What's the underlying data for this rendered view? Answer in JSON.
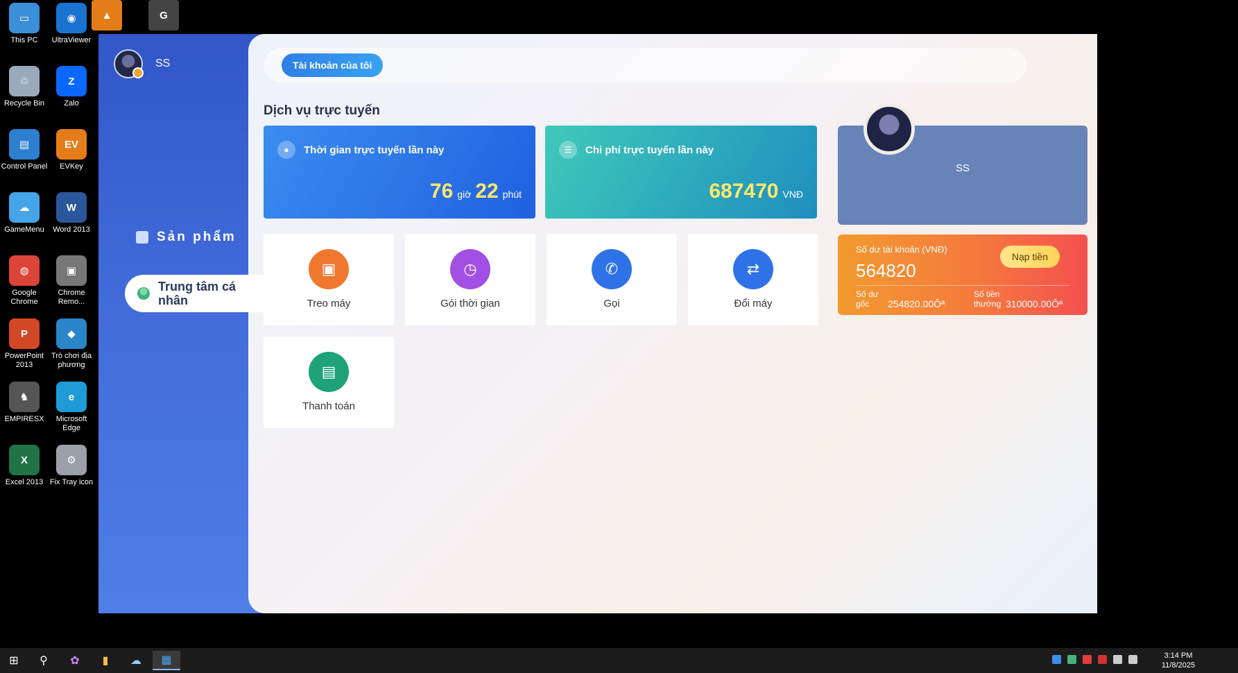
{
  "desktop": {
    "icons": [
      {
        "label": "This PC",
        "name": "this-pc-icon",
        "color": "#3b8fd8"
      },
      {
        "label": "UltraViewer",
        "name": "ultraviewer-icon",
        "color": "#1a73d1"
      },
      {
        "label": "Recycle Bin",
        "name": "recycle-bin-icon",
        "color": "#9ab"
      },
      {
        "label": "Zalo",
        "name": "zalo-icon",
        "color": "#0a68ff"
      },
      {
        "label": "Control Panel",
        "name": "control-panel-icon",
        "color": "#2d7fd0"
      },
      {
        "label": "EVKey",
        "name": "evkey-icon",
        "color": "#e57c1a"
      },
      {
        "label": "GameMenu",
        "name": "gamemenu-icon",
        "color": "#46a5e8"
      },
      {
        "label": "Word 2013",
        "name": "word-icon",
        "color": "#2b579a"
      },
      {
        "label": "Google Chrome",
        "name": "chrome-icon",
        "color": "#db4437"
      },
      {
        "label": "Chrome Remo...",
        "name": "chrome-remote-icon",
        "color": "#777"
      },
      {
        "label": "PowerPoint 2013",
        "name": "powerpoint-icon",
        "color": "#d24726"
      },
      {
        "label": "Trò chơi địa phương",
        "name": "local-games-icon",
        "color": "#2a85c9"
      },
      {
        "label": "EMPIRESX",
        "name": "empiresx-icon",
        "color": "#555"
      },
      {
        "label": "Microsoft Edge",
        "name": "edge-icon",
        "color": "#1f9cd8"
      },
      {
        "label": "Excel 2013",
        "name": "excel-icon",
        "color": "#217346"
      },
      {
        "label": "Fix Tray icon",
        "name": "fix-tray-icon",
        "color": "#9aa0a8"
      }
    ]
  },
  "sidebar": {
    "username": "SS",
    "products_label": "Sản phẩm",
    "center_label": "Trung tâm cá nhân"
  },
  "topbar": {
    "tab_label": "Tài khoản của tôi",
    "close_glyph": "×"
  },
  "main": {
    "section_title": "Dịch vụ trực tuyến",
    "time_card": {
      "title": "Thời gian trực tuyến lần này",
      "hours": "76",
      "hours_unit": "giờ",
      "minutes": "22",
      "minutes_unit": "phút"
    },
    "cost_card": {
      "title": "Chi phí trực tuyến lần này",
      "amount": "687470",
      "unit": "VNĐ"
    },
    "profile": {
      "name": "SS"
    },
    "balance": {
      "label": "Số dư tài khoản (VNĐ)",
      "amount": "564820",
      "topup_label": "Nạp tiền",
      "base_label": "Số dư gốc",
      "base_value": "254820.00Ôª",
      "bonus_label": "Số tiền thưởng",
      "bonus_value": "310000.00Ôª"
    },
    "tiles": [
      {
        "label": "Treo máy",
        "name": "treo-may-tile",
        "icon": "monitor-lock-icon",
        "color": "#f0782e"
      },
      {
        "label": "Gói thời gian",
        "name": "goi-thoi-gian-tile",
        "icon": "briefcase-clock-icon",
        "color": "#a24fe3"
      },
      {
        "label": "Gọi",
        "name": "goi-tile",
        "icon": "phone-icon",
        "color": "#2f72e8"
      },
      {
        "label": "Đổi máy",
        "name": "doi-may-tile",
        "icon": "swap-icon",
        "color": "#2f72e8"
      },
      {
        "label": "Thanh toán",
        "name": "thanh-toan-tile",
        "icon": "wallet-icon",
        "color": "#1ea27a"
      }
    ]
  },
  "taskbar": {
    "time": "3:14 PM",
    "date": "11/8/2025"
  }
}
